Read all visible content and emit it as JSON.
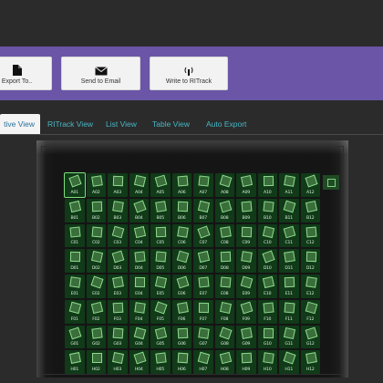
{
  "toolbar": {
    "buttons": [
      {
        "label": "Export To..",
        "icon": "file-icon"
      },
      {
        "label": "Send to Email",
        "icon": "envelope-icon"
      },
      {
        "label": "Write to RITrack",
        "icon": "antenna-icon"
      }
    ]
  },
  "tabs": [
    {
      "label": "tive View",
      "active": true
    },
    {
      "label": "RITrack View",
      "active": false
    },
    {
      "label": "List View",
      "active": false
    },
    {
      "label": "Table View",
      "active": false
    },
    {
      "label": "Auto Export",
      "active": false
    }
  ],
  "plate": {
    "rows": [
      "A",
      "B",
      "C",
      "D",
      "E",
      "F",
      "G",
      "H"
    ],
    "cols": [
      "01",
      "02",
      "03",
      "04",
      "05",
      "06",
      "07",
      "08",
      "09",
      "10",
      "11",
      "12"
    ],
    "selected_well": "A01"
  },
  "colors": {
    "purple_band": "#6a55a6",
    "tab_text": "#48b7c4",
    "well_green": "#103a18"
  }
}
